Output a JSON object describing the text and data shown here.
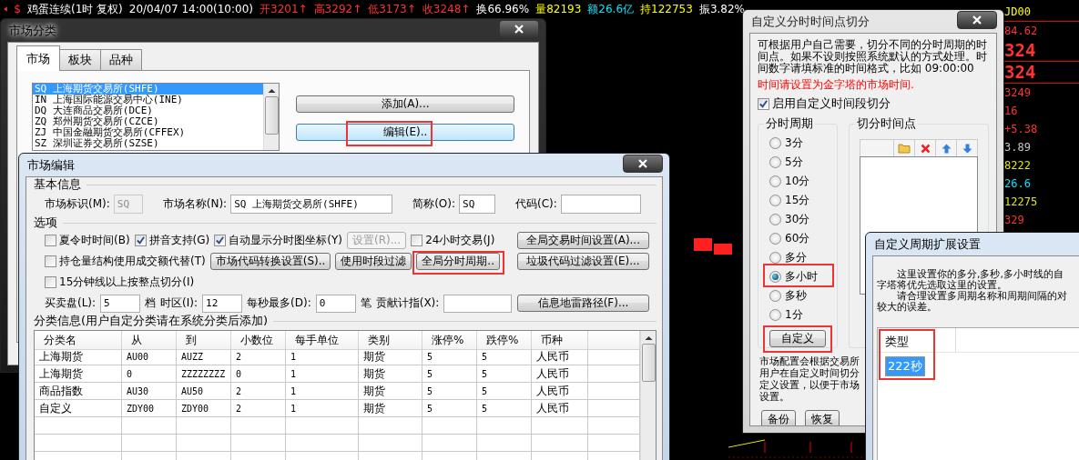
{
  "top_bar": {
    "symbol": "$",
    "items": [
      {
        "text": "鸡蛋连续(1时 复权)",
        "color": "#ffffff"
      },
      {
        "text": "20/04/07 14:00(10:00)",
        "color": "#ffffff"
      },
      {
        "text": "开3201↑",
        "color": "#ff3232"
      },
      {
        "text": "高3292↑",
        "color": "#ff3232"
      },
      {
        "text": "低3173↑",
        "color": "#ff3232"
      },
      {
        "text": "收3248↑",
        "color": "#ff3232"
      },
      {
        "text": "换66.96%",
        "color": "#ffffff"
      },
      {
        "text": "量82193",
        "color": "#ffff00"
      },
      {
        "text": "额26.6亿",
        "color": "#00e5ff"
      },
      {
        "text": "持122753",
        "color": "#ffff00"
      },
      {
        "text": "振3.82%",
        "color": "#ffffff"
      }
    ]
  },
  "quote_panel": {
    "code": "JD00",
    "values": [
      {
        "text": "84.62",
        "color": "#ff3232",
        "kind": "normal"
      },
      {
        "text": "324",
        "color": "#ff3232",
        "kind": "large"
      },
      {
        "text": "324",
        "color": "#ff3232",
        "kind": "large"
      },
      {
        "text": "3249",
        "color": "#ff3232",
        "kind": "normal"
      },
      {
        "text": "16",
        "color": "#ff3232",
        "kind": "normal"
      },
      {
        "text": "+5.38",
        "color": "#ff3232",
        "kind": "normal"
      },
      {
        "text": "3.89",
        "color": "#c8c8c8",
        "kind": "normal"
      },
      {
        "text": "8222",
        "color": "#e6e600",
        "kind": "normal"
      },
      {
        "text": "26.6",
        "color": "#00e5ff",
        "kind": "normal"
      },
      {
        "text": "12275",
        "color": "#e6e600",
        "kind": "normal"
      },
      {
        "text": "329",
        "color": "#ff3232",
        "kind": "normal"
      }
    ]
  },
  "market_category_window": {
    "title": "市场分类",
    "tabs": [
      {
        "label": "市场",
        "selected": true
      },
      {
        "label": "板块",
        "selected": false
      },
      {
        "label": "品种",
        "selected": false
      }
    ],
    "exchanges": [
      {
        "label": "SQ 上海期货交易所(SHFE)",
        "selected": true
      },
      {
        "label": "IN 上海国际能源交易中心(INE)",
        "selected": false
      },
      {
        "label": "DQ 大连商品交易所(DCE)",
        "selected": false
      },
      {
        "label": "ZQ 郑州期货交易所(CZCE)",
        "selected": false
      },
      {
        "label": "ZJ 中国金融期货交易所(CFFEX)",
        "selected": false
      },
      {
        "label": "SZ 深圳证券交易所(SZSE)",
        "selected": false
      }
    ],
    "buttons": [
      {
        "label": "添加(A)...",
        "focused": false
      },
      {
        "label": "编辑(E)..",
        "focused": true
      }
    ]
  },
  "market_edit_window": {
    "title": "市场编辑",
    "basic_info": {
      "heading": "基本信息",
      "fields": [
        {
          "label": "市场标识(M):",
          "value": "SQ",
          "disabled": true
        },
        {
          "label": "市场名称(N):",
          "value": "SQ 上海期货交易所(SHFE)",
          "disabled": false
        },
        {
          "label": "简称(O):",
          "value": "SQ",
          "disabled": false
        },
        {
          "label": "代码(C):",
          "disabled": false
        }
      ]
    },
    "options": {
      "heading": "选项",
      "rows": [
        {
          "items": [
            {
              "kind": "checkbox",
              "label": "夏令时时间(B)",
              "checked": false
            },
            {
              "kind": "checkbox",
              "label": "拼音支持(G)",
              "checked": true
            },
            {
              "kind": "checkbox",
              "label": "自动显示分时图坐标(Y)",
              "checked": true
            },
            {
              "kind": "button",
              "label": "设置(R)...",
              "disabled": true
            },
            {
              "kind": "checkbox",
              "label": "24小时交易(J)",
              "checked": false
            }
          ],
          "side_button": "全局交易时间设置(A)..."
        },
        {
          "items": [
            {
              "kind": "checkbox",
              "label": "持仓量结构使用成交额代替(T)",
              "checked": false
            },
            {
              "kind": "button",
              "label": "市场代码转换设置(S)..",
              "disabled": false
            },
            {
              "kind": "button",
              "label": "使用时段过滤",
              "disabled": false
            },
            {
              "kind": "button",
              "label": "全局分时周期..",
              "disabled": false
            }
          ],
          "side_button": "垃圾代码过滤设置(E)..."
        },
        {
          "items": [
            {
              "kind": "checkbox",
              "label": "15分钟线以上按整点切分(I)",
              "checked": false
            }
          ]
        },
        {
          "items": [
            {
              "kind": "label",
              "label": "买卖盘(L):"
            },
            {
              "kind": "field",
              "value": "5"
            },
            {
              "kind": "label",
              "label": "档"
            },
            {
              "kind": "label",
              "label": "时区(I):"
            },
            {
              "kind": "field",
              "value": "12"
            },
            {
              "kind": "label",
              "label": "每秒最多(D):"
            },
            {
              "kind": "field",
              "value": "0"
            },
            {
              "kind": "label",
              "label": "笔"
            },
            {
              "kind": "label",
              "label": "贡献计指(X):"
            },
            {
              "kind": "field"
            }
          ],
          "side_button": "信息地雷路径(F)..."
        }
      ]
    },
    "categories": {
      "heading": "分类信息(用户自定分类请在系统分类后添加)",
      "columns": [
        "分类名",
        "从",
        "到",
        "小数位",
        "每手单位",
        "类别",
        "涨停%",
        "跌停%",
        "币种"
      ],
      "rows": [
        [
          "上海期货",
          "AU00",
          "AUZZ",
          "2",
          "1",
          "期货",
          "5",
          "5",
          "人民币"
        ],
        [
          "上海期货",
          "0",
          "ZZZZZZZZ",
          "0",
          "1",
          "期货",
          "5",
          "5",
          "人民币"
        ],
        [
          "商品指数",
          "AU30",
          "AU50",
          "2",
          "1",
          "期货",
          "5",
          "5",
          "人民币"
        ],
        [
          "自定义",
          "ZDY00",
          "ZDY00",
          "2",
          "1",
          "期货",
          "5",
          "5",
          "人民币"
        ]
      ]
    }
  },
  "split_window": {
    "title": "自定义分时时间点切分",
    "description": "可根据用户自己需要，切分不同的分时周期的时间点。如果不设则按照系统默认的方式处理。时间数字请填标准的时间格式，比如 09:00:00",
    "warning": "时间请设置为金字塔的市场时间.",
    "enable": {
      "label": "启用自定义时间段切分",
      "checked": true
    },
    "period_group": {
      "title": "分时周期",
      "options": [
        {
          "label": "3分",
          "selected": false
        },
        {
          "label": "5分",
          "selected": false
        },
        {
          "label": "10分",
          "selected": false
        },
        {
          "label": "15分",
          "selected": false
        },
        {
          "label": "30分",
          "selected": false
        },
        {
          "label": "60分",
          "selected": false
        },
        {
          "label": "多分",
          "selected": false
        },
        {
          "label": "多小时",
          "selected": true
        },
        {
          "label": "多秒",
          "selected": false
        },
        {
          "label": "1分",
          "selected": false
        }
      ],
      "custom_button": "自定义"
    },
    "split_group": {
      "title": "切分时间点"
    },
    "note": "市场配置会根据交易所用户在自定义时间切分定义设置，以便于市场设置。",
    "buttons": [
      "备份",
      "恢复"
    ]
  },
  "period_ext_window": {
    "title": "自定义周期扩展设置",
    "paragraphs": [
      [
        "这里设置你的多分,多秒,多小时线的自",
        "字塔将优先选取这里的设置。"
      ],
      [
        "请合理设置多周期名称和周期间隔的对",
        "较大的误差。"
      ]
    ],
    "list": {
      "column": "类型",
      "items": [
        {
          "label": "222秒",
          "selected": true
        }
      ]
    }
  }
}
